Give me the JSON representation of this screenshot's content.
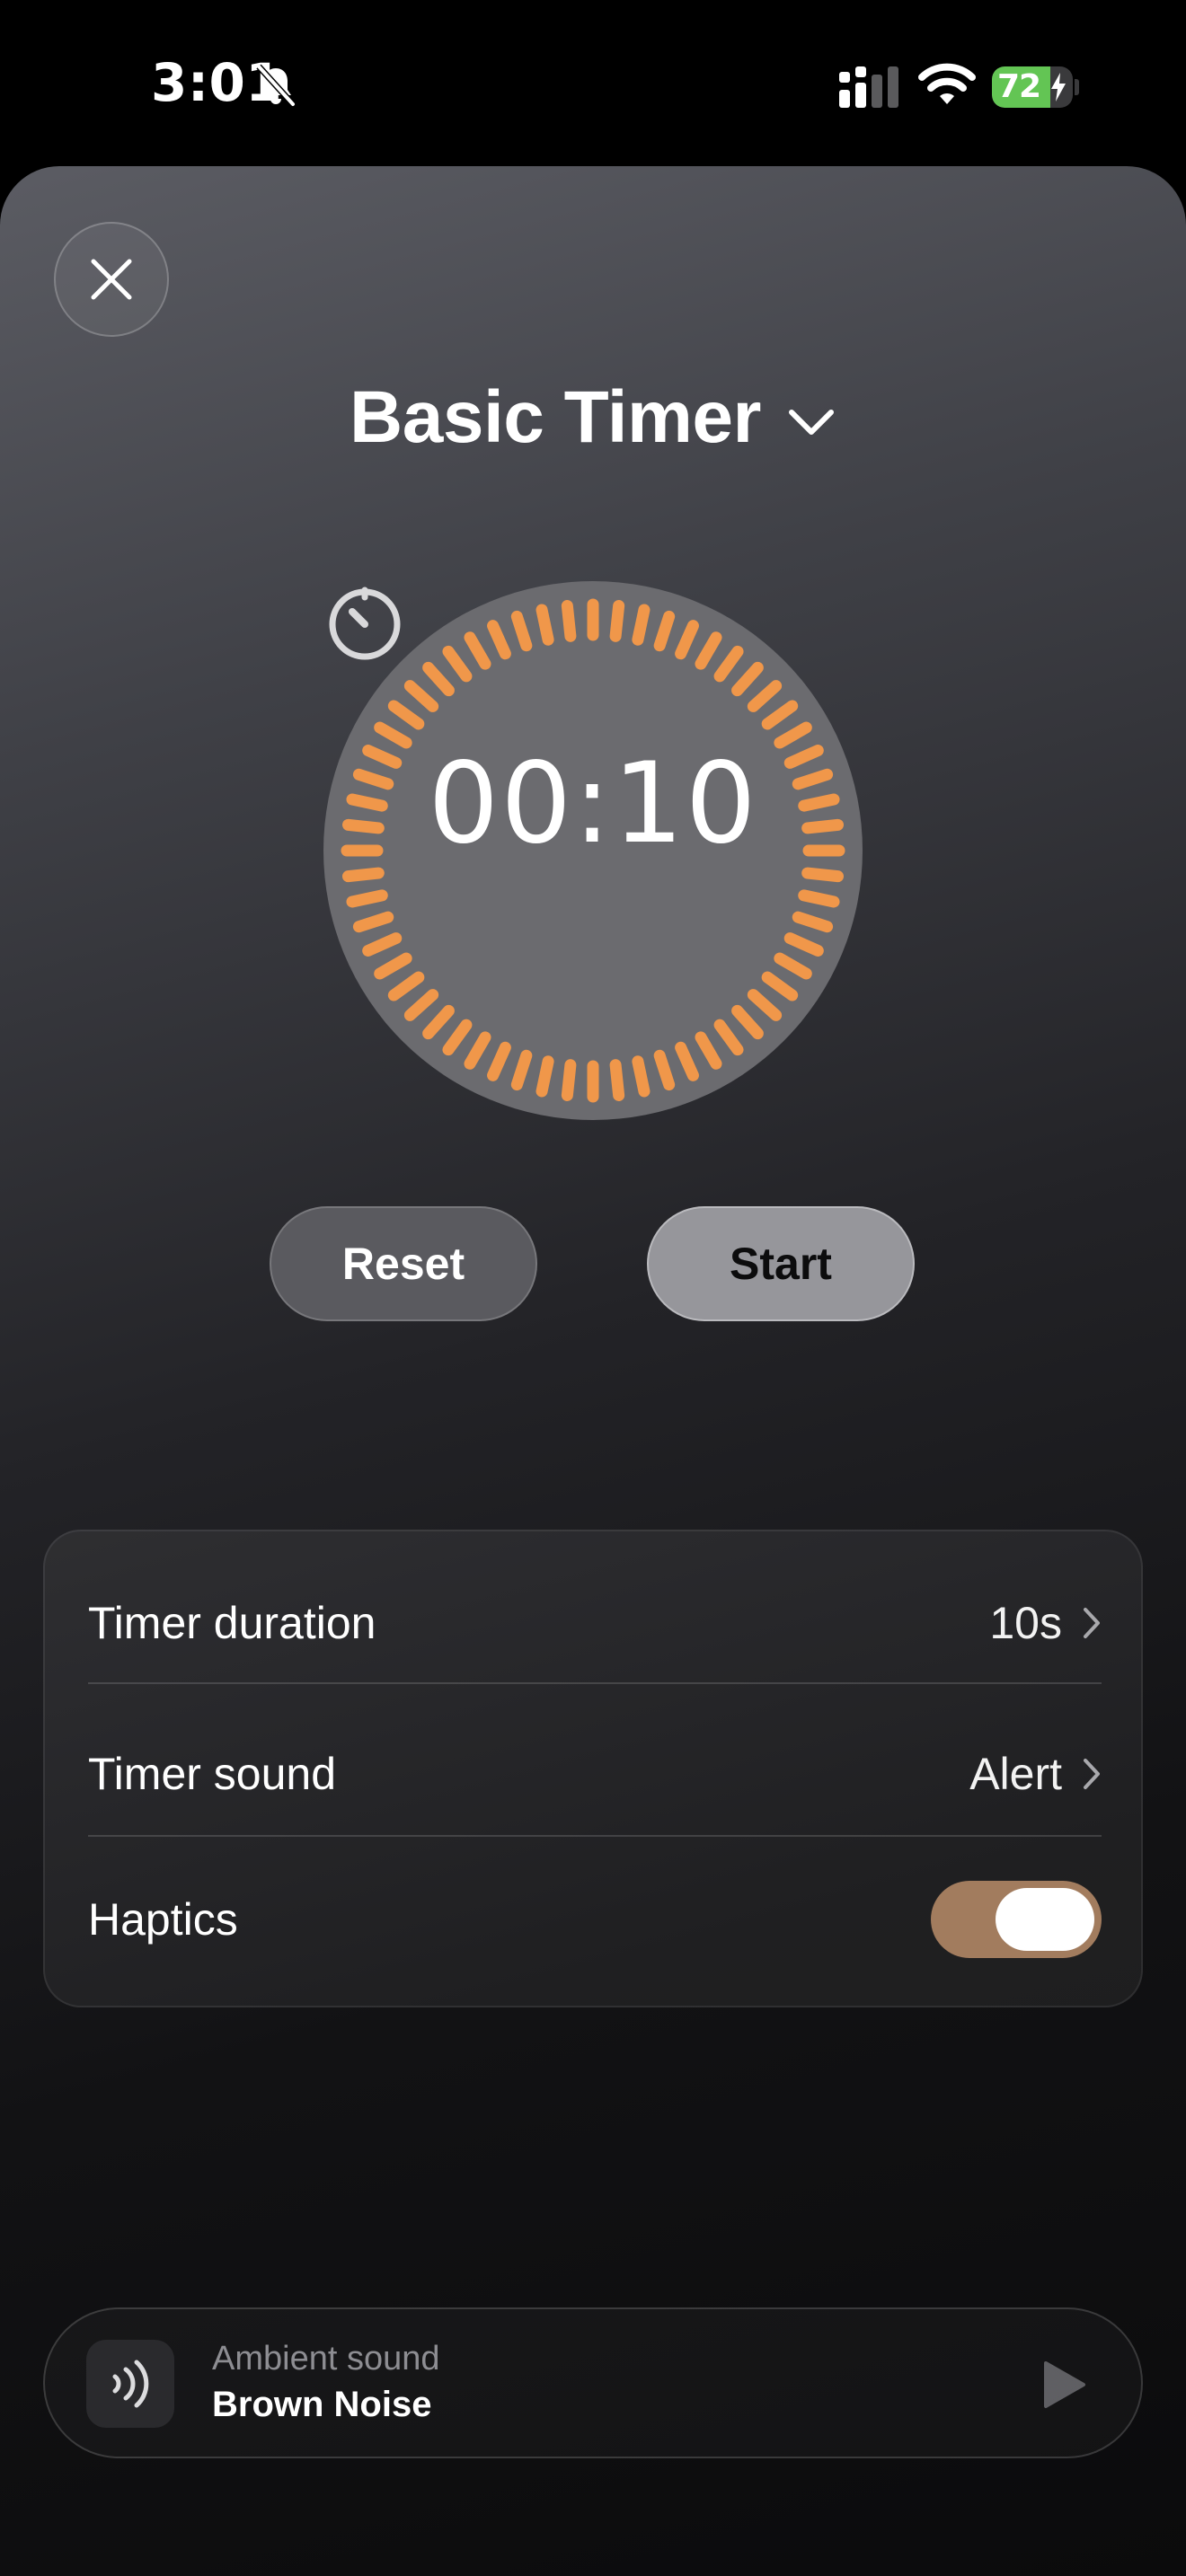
{
  "status_bar": {
    "time": "3:01",
    "battery_level": "72",
    "battery_fraction": 0.72,
    "icons": [
      "bell-slash-icon",
      "signal-icon",
      "wifi-icon",
      "battery-charging-icon"
    ]
  },
  "sheet": {
    "title": "Basic Timer",
    "close_icon": "close-icon",
    "title_chevron_icon": "chevron-down-icon"
  },
  "timer": {
    "display": "00:10",
    "icon": "stopwatch-icon",
    "accent_color": "#f0974a",
    "tick_count": 60
  },
  "controls": {
    "reset_label": "Reset",
    "start_label": "Start"
  },
  "settings": {
    "duration_label": "Timer duration",
    "duration_value": "10s",
    "sound_label": "Timer sound",
    "sound_value": "Alert",
    "haptics_label": "Haptics",
    "haptics_on": true,
    "toggle_color": "#a27c5e"
  },
  "ambient": {
    "caption": "Ambient sound",
    "title": "Brown Noise",
    "icon": "sound-waves-icon",
    "play_icon": "play-icon"
  }
}
